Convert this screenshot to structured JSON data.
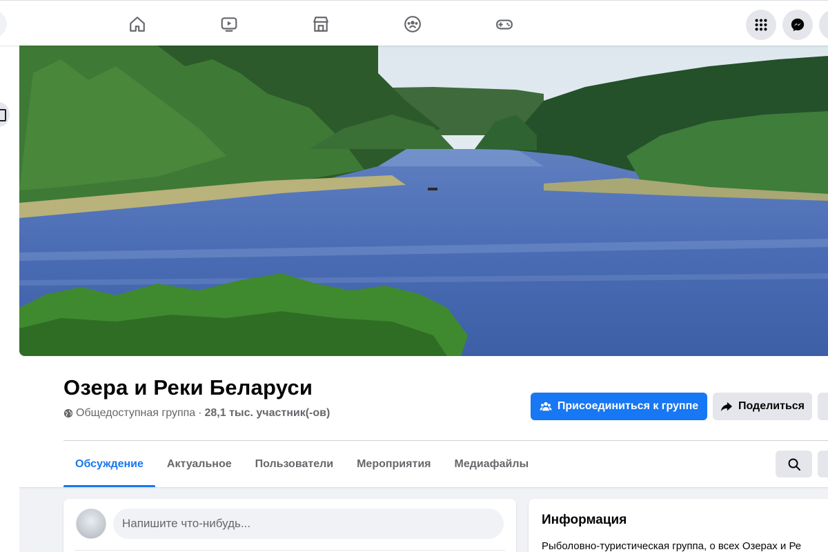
{
  "topbar": {
    "tabs": [
      {
        "name": "home",
        "icon": "home-icon"
      },
      {
        "name": "watch",
        "icon": "video-icon"
      },
      {
        "name": "marketplace",
        "icon": "store-icon"
      },
      {
        "name": "groups",
        "icon": "groups-icon"
      },
      {
        "name": "gaming",
        "icon": "gamepad-icon"
      }
    ],
    "right_buttons": [
      {
        "name": "menu",
        "icon": "grid-menu-icon"
      },
      {
        "name": "messenger",
        "icon": "messenger-icon"
      }
    ]
  },
  "group": {
    "title": "Озера и Реки Беларуси",
    "privacy": "Общедоступная группа",
    "separator": "·",
    "members": "28,1 тыс. участник(-ов)",
    "join_label": "Присоединиться к группе",
    "share_label": "Поделиться"
  },
  "tabs": [
    {
      "label": "Обсуждение",
      "active": true
    },
    {
      "label": "Актуальное",
      "active": false
    },
    {
      "label": "Пользователи",
      "active": false
    },
    {
      "label": "Мероприятия",
      "active": false
    },
    {
      "label": "Медиафайлы",
      "active": false
    }
  ],
  "composer": {
    "placeholder": "Напишите что-нибудь..."
  },
  "info": {
    "title": "Информация",
    "description": "Рыболовно-туристическая группа, о всех Озерах и Ре"
  },
  "colors": {
    "accent": "#1877f2",
    "background": "#f0f2f5",
    "button_gray": "#e4e6eb",
    "text_secondary": "#65676b"
  }
}
